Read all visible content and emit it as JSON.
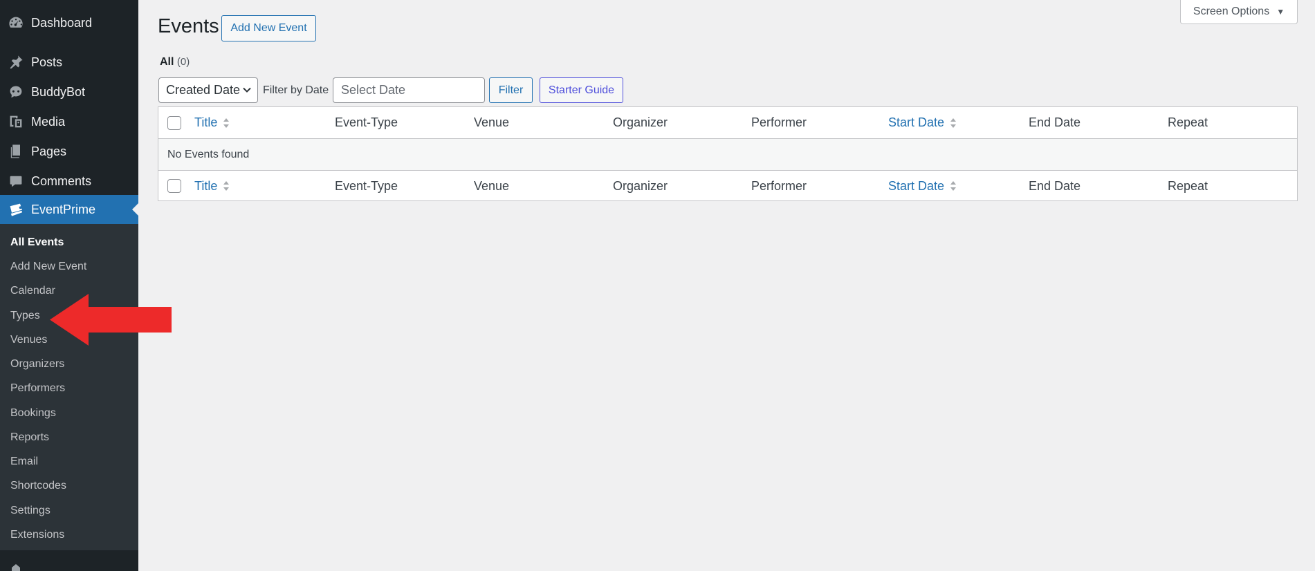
{
  "sidebar": {
    "top_items": [
      {
        "label": "Dashboard",
        "icon": "dashboard-icon"
      },
      {
        "label": "Posts",
        "icon": "pushpin-icon"
      },
      {
        "label": "BuddyBot",
        "icon": "robot-icon"
      },
      {
        "label": "Media",
        "icon": "media-icon"
      },
      {
        "label": "Pages",
        "icon": "pages-icon"
      },
      {
        "label": "Comments",
        "icon": "comment-icon"
      },
      {
        "label": "EventPrime",
        "icon": "tickets-icon",
        "current": true
      }
    ],
    "submenu": [
      {
        "label": "All Events",
        "current": true
      },
      {
        "label": "Add New Event"
      },
      {
        "label": "Calendar"
      },
      {
        "label": "Types"
      },
      {
        "label": "Venues"
      },
      {
        "label": "Organizers"
      },
      {
        "label": "Performers"
      },
      {
        "label": "Bookings"
      },
      {
        "label": "Reports"
      },
      {
        "label": "Email"
      },
      {
        "label": "Shortcodes"
      },
      {
        "label": "Settings"
      },
      {
        "label": "Extensions"
      }
    ]
  },
  "header": {
    "title": "Events",
    "add_new_label": "Add New Event",
    "screen_options_label": "Screen Options"
  },
  "views": {
    "all_label": "All",
    "all_count": "(0)"
  },
  "filters": {
    "date_select_value": "Created Date",
    "filter_by_label": "Filter by Date",
    "date_placeholder": "Select Date",
    "filter_button": "Filter",
    "starter_guide_button": "Starter Guide"
  },
  "table": {
    "columns": [
      {
        "label": "Title",
        "sortable": true
      },
      {
        "label": "Event-Type",
        "sortable": false
      },
      {
        "label": "Venue",
        "sortable": false
      },
      {
        "label": "Organizer",
        "sortable": false
      },
      {
        "label": "Performer",
        "sortable": false
      },
      {
        "label": "Start Date",
        "sortable": true
      },
      {
        "label": "End Date",
        "sortable": false
      },
      {
        "label": "Repeat",
        "sortable": false
      }
    ],
    "empty_message": "No Events found"
  },
  "annotation": {
    "arrow_color": "#ed2a2a"
  },
  "colors": {
    "sidebar_bg": "#1d2327",
    "submenu_bg": "#2c3338",
    "accent": "#2271b1",
    "page_bg": "#f0f0f1"
  }
}
